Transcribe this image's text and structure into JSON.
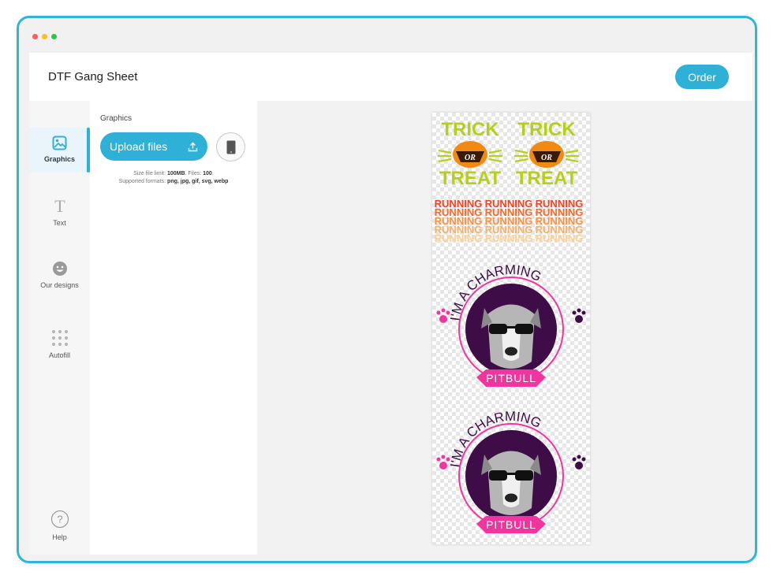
{
  "window": {
    "title": "DTF Gang Sheet",
    "order_label": "Order"
  },
  "rail": {
    "items": [
      {
        "label": "Graphics",
        "icon": "image-icon"
      },
      {
        "label": "Text",
        "icon": "text-icon"
      },
      {
        "label": "Our designs",
        "icon": "smiley-icon"
      },
      {
        "label": "Autofill",
        "icon": "grid-dots-icon"
      }
    ],
    "help_label": "Help",
    "help_glyph": "?"
  },
  "panel": {
    "title": "Graphics",
    "upload_label": "Upload files",
    "note_line1_prefix": "Size file limit: ",
    "note_size": "100MB",
    "note_files_prefix": ". Files: ",
    "note_files": "100",
    "note_line1_suffix": ".",
    "note_formats_prefix": "Supported formats: ",
    "note_formats": "png, jpg, gif, svg, webp"
  },
  "sheet": {
    "designs": [
      {
        "name": "trick-or-treat",
        "line1": "TRICK",
        "line2": "OR",
        "line3": "TREAT"
      },
      {
        "name": "running",
        "word": "RUNNING"
      },
      {
        "name": "charming-pitbull",
        "arc_text": "I'M A CHARMING",
        "banner": "PITBULL"
      }
    ]
  },
  "colors": {
    "accent": "#2fb0d6",
    "frame": "#31b5d6",
    "trick_green": "#b7cf1a",
    "pumpkin": "#f08a12",
    "pink": "#f0369e",
    "purple": "#3e0d48"
  }
}
